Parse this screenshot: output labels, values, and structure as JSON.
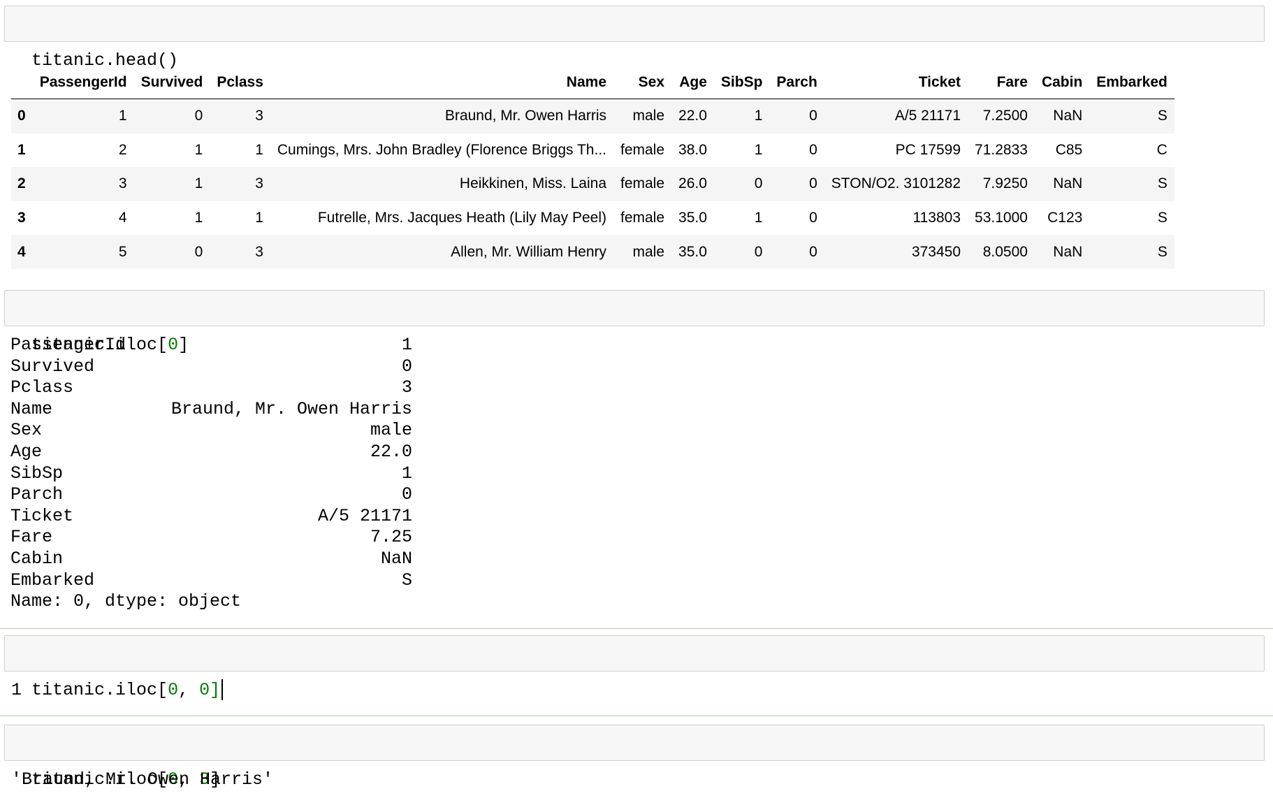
{
  "cells": {
    "c1": {
      "code_prefix": "titanic.head()"
    },
    "c2": {
      "code_prefix": "titanic.iloc[",
      "arg1": "0",
      "code_suffix": "]"
    },
    "c3": {
      "code_prefix": "titanic.iloc[",
      "arg1": "0",
      "comma": ", ",
      "arg2": "0",
      "code_suffix": "]",
      "output": "1"
    },
    "c4": {
      "code_prefix": "titanic.iloc[",
      "arg1": "0",
      "comma": ", ",
      "arg2": "3",
      "code_suffix": "]",
      "output": "'Braund, Mr. Owen Harris'"
    }
  },
  "dataframe": {
    "columns": [
      "",
      "PassengerId",
      "Survived",
      "Pclass",
      "Name",
      "Sex",
      "Age",
      "SibSp",
      "Parch",
      "Ticket",
      "Fare",
      "Cabin",
      "Embarked"
    ],
    "rows": [
      [
        "0",
        "1",
        "0",
        "3",
        "Braund, Mr. Owen Harris",
        "male",
        "22.0",
        "1",
        "0",
        "A/5 21171",
        "7.2500",
        "NaN",
        "S"
      ],
      [
        "1",
        "2",
        "1",
        "1",
        "Cumings, Mrs. John Bradley (Florence Briggs Th...",
        "female",
        "38.0",
        "1",
        "0",
        "PC 17599",
        "71.2833",
        "C85",
        "C"
      ],
      [
        "2",
        "3",
        "1",
        "3",
        "Heikkinen, Miss. Laina",
        "female",
        "26.0",
        "0",
        "0",
        "STON/O2. 3101282",
        "7.9250",
        "NaN",
        "S"
      ],
      [
        "3",
        "4",
        "1",
        "1",
        "Futrelle, Mrs. Jacques Heath (Lily May Peel)",
        "female",
        "35.0",
        "1",
        "0",
        "113803",
        "53.1000",
        "C123",
        "S"
      ],
      [
        "4",
        "5",
        "0",
        "3",
        "Allen, Mr. William Henry",
        "male",
        "35.0",
        "0",
        "0",
        "373450",
        "8.0500",
        "NaN",
        "S"
      ]
    ]
  },
  "series": {
    "rows": [
      [
        "PassengerId",
        "1"
      ],
      [
        "Survived",
        "0"
      ],
      [
        "Pclass",
        "3"
      ],
      [
        "Name",
        "Braund, Mr. Owen Harris"
      ],
      [
        "Sex",
        "male"
      ],
      [
        "Age",
        "22.0"
      ],
      [
        "SibSp",
        "1"
      ],
      [
        "Parch",
        "0"
      ],
      [
        "Ticket",
        "A/5 21171"
      ],
      [
        "Fare",
        "7.25"
      ],
      [
        "Cabin",
        "NaN"
      ],
      [
        "Embarked",
        "S"
      ]
    ],
    "footer": "Name: 0, dtype: object"
  },
  "colors": {
    "code_number": "#008000",
    "input_background": "#f7f7f7",
    "active_cell_border": "#a9cfa0"
  }
}
